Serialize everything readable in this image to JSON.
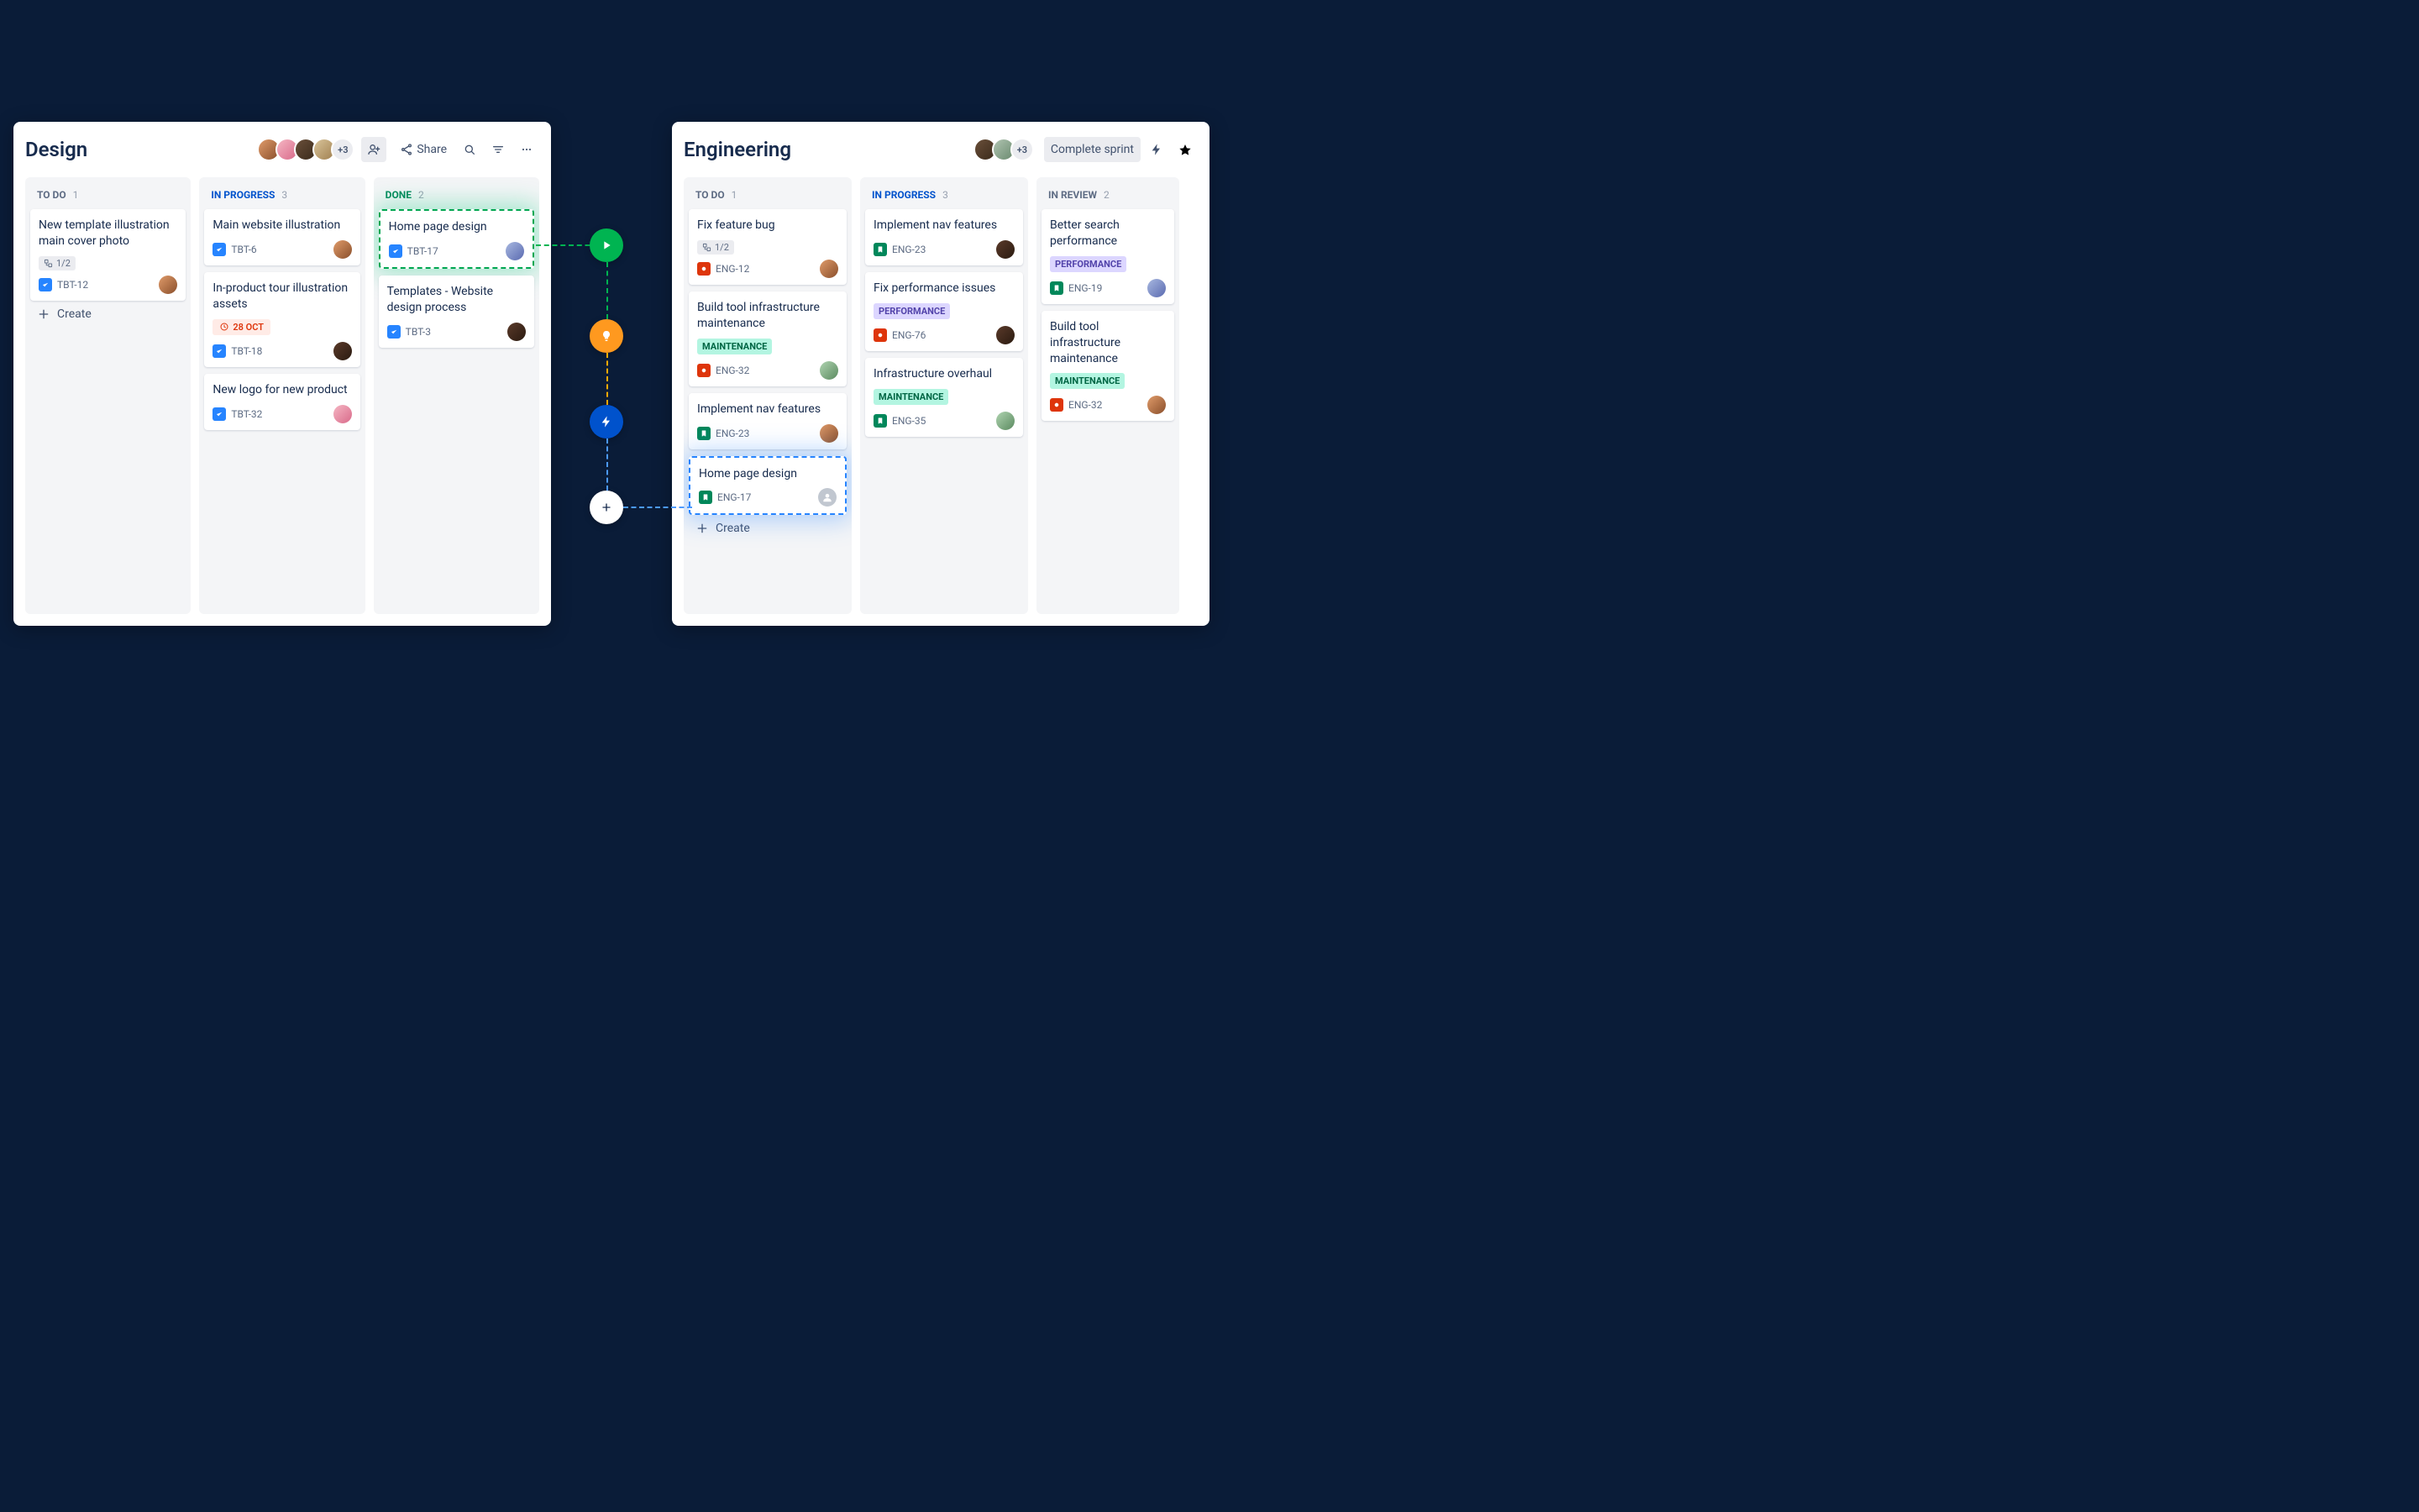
{
  "boards": {
    "design": {
      "title": "Design",
      "avatar_overflow": "+3",
      "share_label": "Share",
      "columns": [
        {
          "name": "TO DO",
          "count": 1,
          "cards": [
            {
              "title": "New template illustration main cover photo",
              "subtasks": "1/2",
              "key": "TBT-12",
              "type": "task"
            }
          ],
          "show_create": true
        },
        {
          "name": "IN PROGRESS",
          "count": 3,
          "cards": [
            {
              "title": "Main website illustration",
              "key": "TBT-6",
              "type": "task"
            },
            {
              "title": "In-product tour illustration assets",
              "due": "28 OCT",
              "key": "TBT-18",
              "type": "task"
            },
            {
              "title": "New logo for new product",
              "key": "TBT-32",
              "type": "task"
            }
          ]
        },
        {
          "name": "DONE",
          "count": 2,
          "cards": [
            {
              "title": "Home page design",
              "key": "TBT-17",
              "type": "task",
              "highlight": "green"
            },
            {
              "title": "Templates - Website design process",
              "key": "TBT-3",
              "type": "task"
            }
          ]
        }
      ],
      "create_label": "Create"
    },
    "engineering": {
      "title": "Engineering",
      "avatar_overflow": "+3",
      "complete_label": "Complete sprint",
      "columns": [
        {
          "name": "TO DO",
          "count": 1,
          "cards": [
            {
              "title": "Fix feature bug",
              "subtasks": "1/2",
              "key": "ENG-12",
              "type": "bug"
            },
            {
              "title": "Build tool infrastructure maintenance",
              "label": "MAINTENANCE",
              "key": "ENG-32",
              "type": "bug"
            },
            {
              "title": "Implement nav features",
              "key": "ENG-23",
              "type": "story"
            },
            {
              "title": "Home page design",
              "key": "ENG-17",
              "type": "story",
              "highlight": "blue",
              "unassigned": true
            }
          ],
          "show_create": true
        },
        {
          "name": "IN PROGRESS",
          "count": 3,
          "cards": [
            {
              "title": "Implement nav features",
              "key": "ENG-23",
              "type": "story"
            },
            {
              "title": "Fix performance issues",
              "label": "PERFORMANCE",
              "key": "ENG-76",
              "type": "bug"
            },
            {
              "title": "Infrastructure overhaul",
              "label": "MAINTENANCE",
              "key": "ENG-35",
              "type": "story"
            }
          ]
        },
        {
          "name": "IN REVIEW",
          "count": 2,
          "cards": [
            {
              "title": "Better search performance",
              "label": "PERFORMANCE",
              "key": "ENG-19",
              "type": "story"
            },
            {
              "title": "Build tool infrastructure maintenance",
              "label": "MAINTENANCE",
              "key": "ENG-32",
              "type": "bug"
            }
          ]
        }
      ],
      "create_label": "Create"
    }
  }
}
